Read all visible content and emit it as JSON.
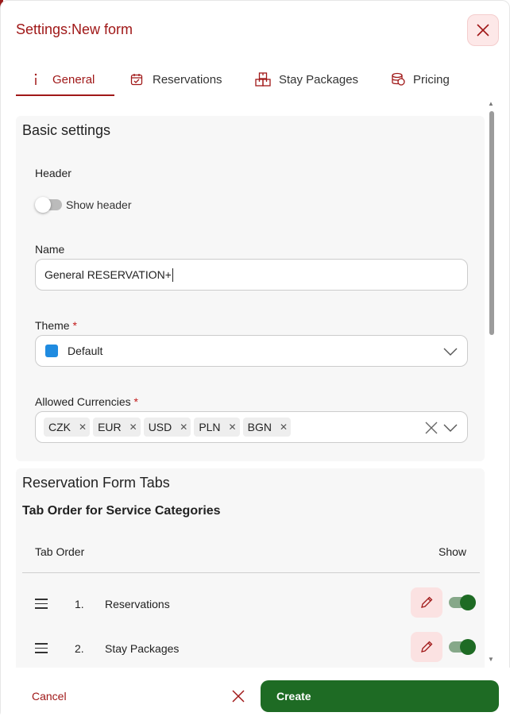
{
  "dialog": {
    "title": "Settings:New form",
    "close_icon": "close-icon"
  },
  "background": {
    "edge_char": "e"
  },
  "tabs": [
    {
      "label": "General",
      "icon": "info-icon",
      "active": true
    },
    {
      "label": "Reservations",
      "icon": "calendar-icon",
      "active": false
    },
    {
      "label": "Stay Packages",
      "icon": "packages-icon",
      "active": false
    },
    {
      "label": "Pricing",
      "icon": "coins-icon",
      "active": false
    }
  ],
  "basic_settings": {
    "title": "Basic settings",
    "header_label": "Header",
    "show_header_label": "Show header",
    "show_header_on": false,
    "name_label": "Name",
    "name_value": "General RESERVATION+",
    "theme_label": "Theme",
    "theme_required": "*",
    "theme_value": "Default",
    "theme_color": "#1f8be0",
    "currencies_label": "Allowed Currencies",
    "currencies_required": "*",
    "currencies": [
      "CZK",
      "EUR",
      "USD",
      "PLN",
      "BGN"
    ]
  },
  "reservation_tabs": {
    "title": "Reservation Form Tabs",
    "subtitle": "Tab Order for Service Categories",
    "col_order": "Tab Order",
    "col_show": "Show",
    "rows": [
      {
        "num": "1.",
        "name": "Reservations",
        "show": true
      },
      {
        "num": "2.",
        "name": "Stay Packages",
        "show": true
      }
    ]
  },
  "footer": {
    "cancel_label": "Cancel",
    "create_label": "Create"
  },
  "colors": {
    "accent": "#a01818",
    "primary": "#1e6b24"
  }
}
